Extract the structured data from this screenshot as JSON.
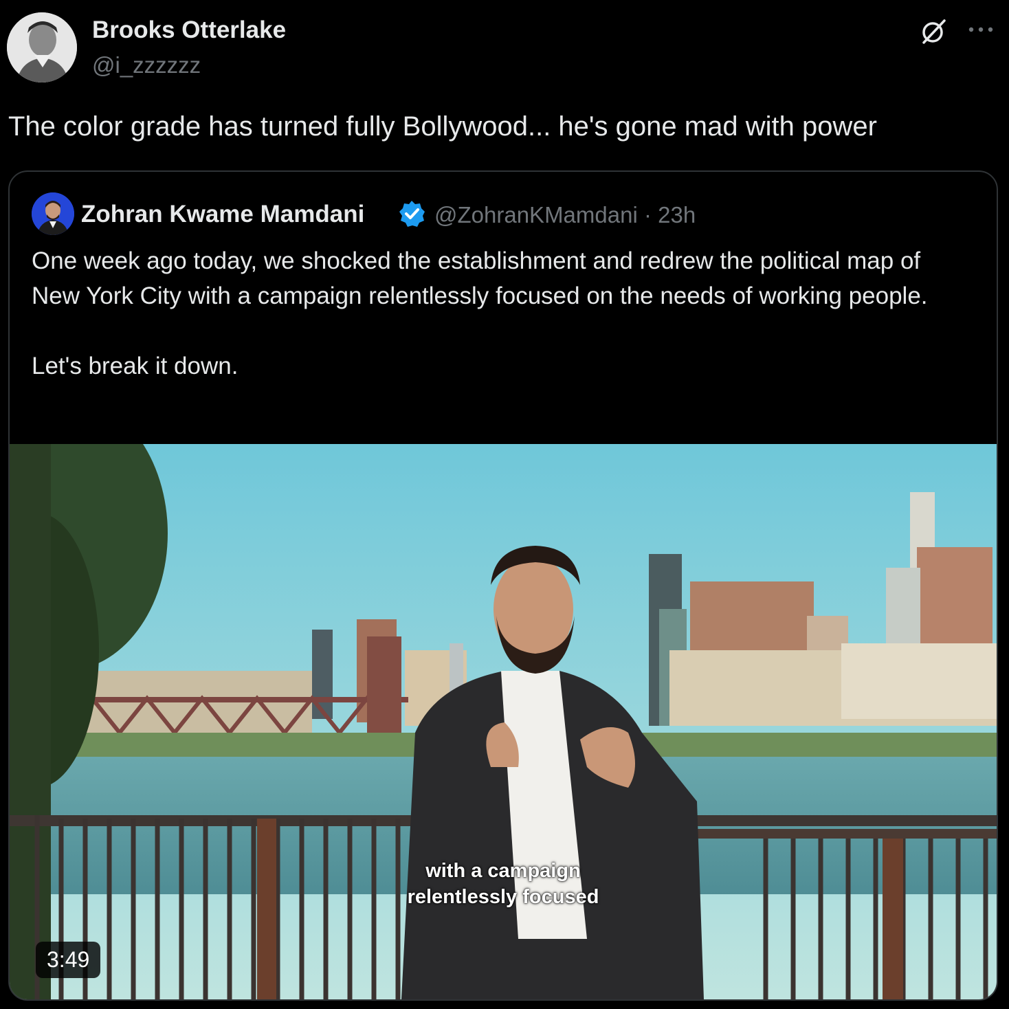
{
  "author": {
    "name": "Brooks Otterlake",
    "handle": "@i_zzzzzz"
  },
  "tweet": {
    "text": "The color grade has turned fully Bollywood... he's gone mad with power"
  },
  "quoted": {
    "name": "Zohran Kwame Mamdani",
    "meta": "@ZohranKMamdani · 23h",
    "text": "One week ago today, we shocked the establishment and redrew the political map of New York City with a campaign relentlessly focused on the needs of working people.\n\nLet's break it down.",
    "video": {
      "caption": "with a campaign\nrelentlessly focused",
      "duration": "3:49"
    }
  },
  "icons": {
    "grok": "grok-icon",
    "more": "more-icon",
    "verified": "verified-badge-icon"
  },
  "colors": {
    "background": "#000000",
    "text": "#e7e9ea",
    "secondary": "#71767b",
    "verified": "#1d9bf0",
    "border": "#2f3336"
  }
}
